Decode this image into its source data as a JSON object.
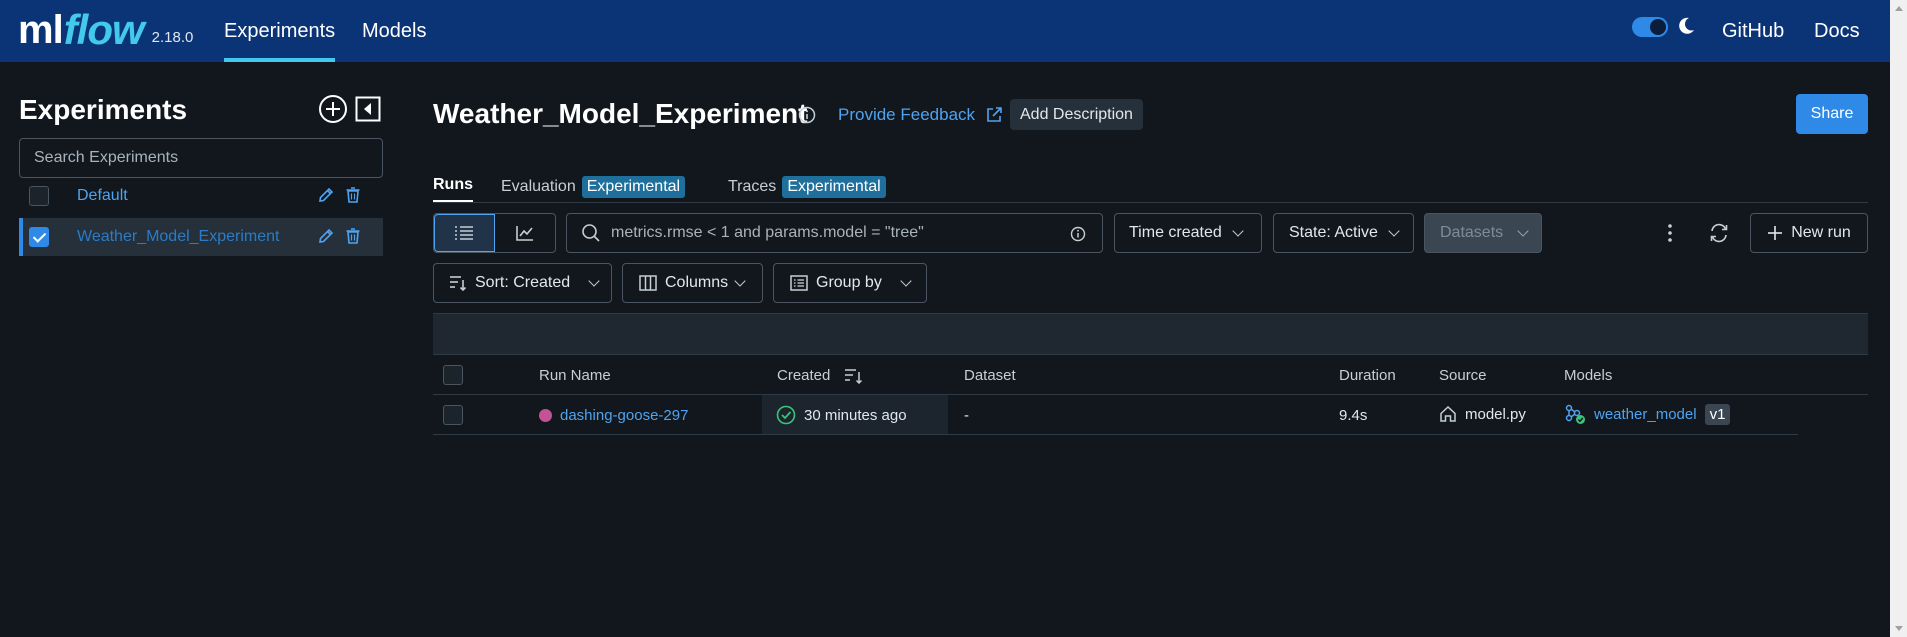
{
  "topbar": {
    "logo_ml": "ml",
    "logo_flow": "flow",
    "version": "2.18.0",
    "nav": [
      {
        "label": "Experiments",
        "active": true
      },
      {
        "label": "Models",
        "active": false
      }
    ],
    "github": "GitHub",
    "docs": "Docs",
    "dark_mode": true
  },
  "sidebar": {
    "title": "Experiments",
    "search_placeholder": "Search Experiments",
    "experiments": [
      {
        "name": "Default",
        "checked": false
      },
      {
        "name": "Weather_Model_Experiment",
        "checked": true
      }
    ]
  },
  "main": {
    "title": "Weather_Model_Experiment",
    "feedback": "Provide Feedback",
    "add_description": "Add Description",
    "share": "Share",
    "tabs": [
      {
        "label": "Runs",
        "badge": ""
      },
      {
        "label": "Evaluation",
        "badge": "Experimental"
      },
      {
        "label": "Traces",
        "badge": "Experimental"
      }
    ],
    "search_placeholder": "metrics.rmse < 1 and params.model = \"tree\"",
    "time_created": "Time created",
    "state": "State: Active",
    "datasets": "Datasets",
    "new_run": "New run",
    "sort": "Sort: Created",
    "columns": "Columns",
    "group_by": "Group by"
  },
  "table": {
    "headers": {
      "run_name": "Run Name",
      "created": "Created",
      "dataset": "Dataset",
      "duration": "Duration",
      "source": "Source",
      "models": "Models"
    },
    "rows": [
      {
        "run_name": "dashing-goose-297",
        "created": "30 minutes ago",
        "dataset": "-",
        "duration": "9.4s",
        "source": "model.py",
        "model": "weather_model",
        "model_version": "v1"
      }
    ]
  },
  "colors": {
    "topbar": "#0b3477",
    "accent": "#43c9ed",
    "primary": "#2e8ae6",
    "link": "#4fa3f0",
    "background": "#11171d",
    "run_dot": "#c45295",
    "success": "#3cc37a"
  }
}
